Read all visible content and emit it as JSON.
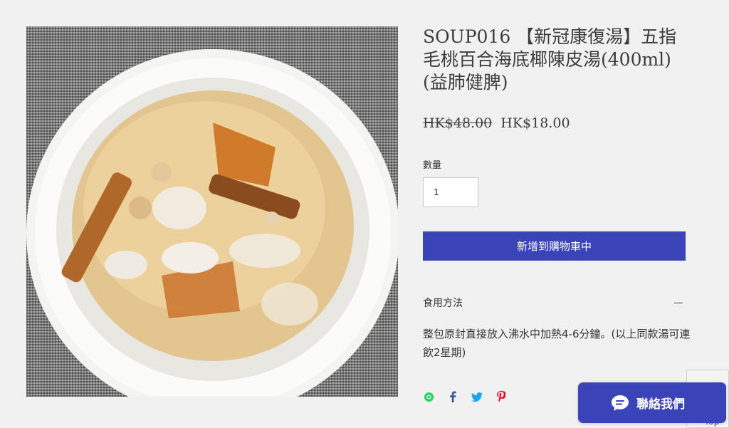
{
  "product": {
    "title": "SOUP016 【新冠康復湯】五指毛桃百合海底椰陳皮湯(400ml)(益肺健脾)",
    "original_price": "HK$48.00",
    "sale_price": "HK$18.00",
    "quantity_label": "數量",
    "quantity_value": "1",
    "add_to_cart_label": "新增到購物車中",
    "info_section": {
      "title": "食用方法",
      "body": "整包原封直接放入沸水中加熱4-6分鐘。(以上同款湯可連飲2星期)"
    }
  },
  "share_icons": [
    "whatsapp-icon",
    "facebook-icon",
    "twitter-icon",
    "pinterest-icon"
  ],
  "back_to_top_label": "Top",
  "chat_button_label": "聯絡我們",
  "colors": {
    "accent": "#3b43b8",
    "whatsapp": "#25d366",
    "facebook": "#3b5998",
    "twitter": "#1da1f2",
    "pinterest": "#e60023"
  }
}
